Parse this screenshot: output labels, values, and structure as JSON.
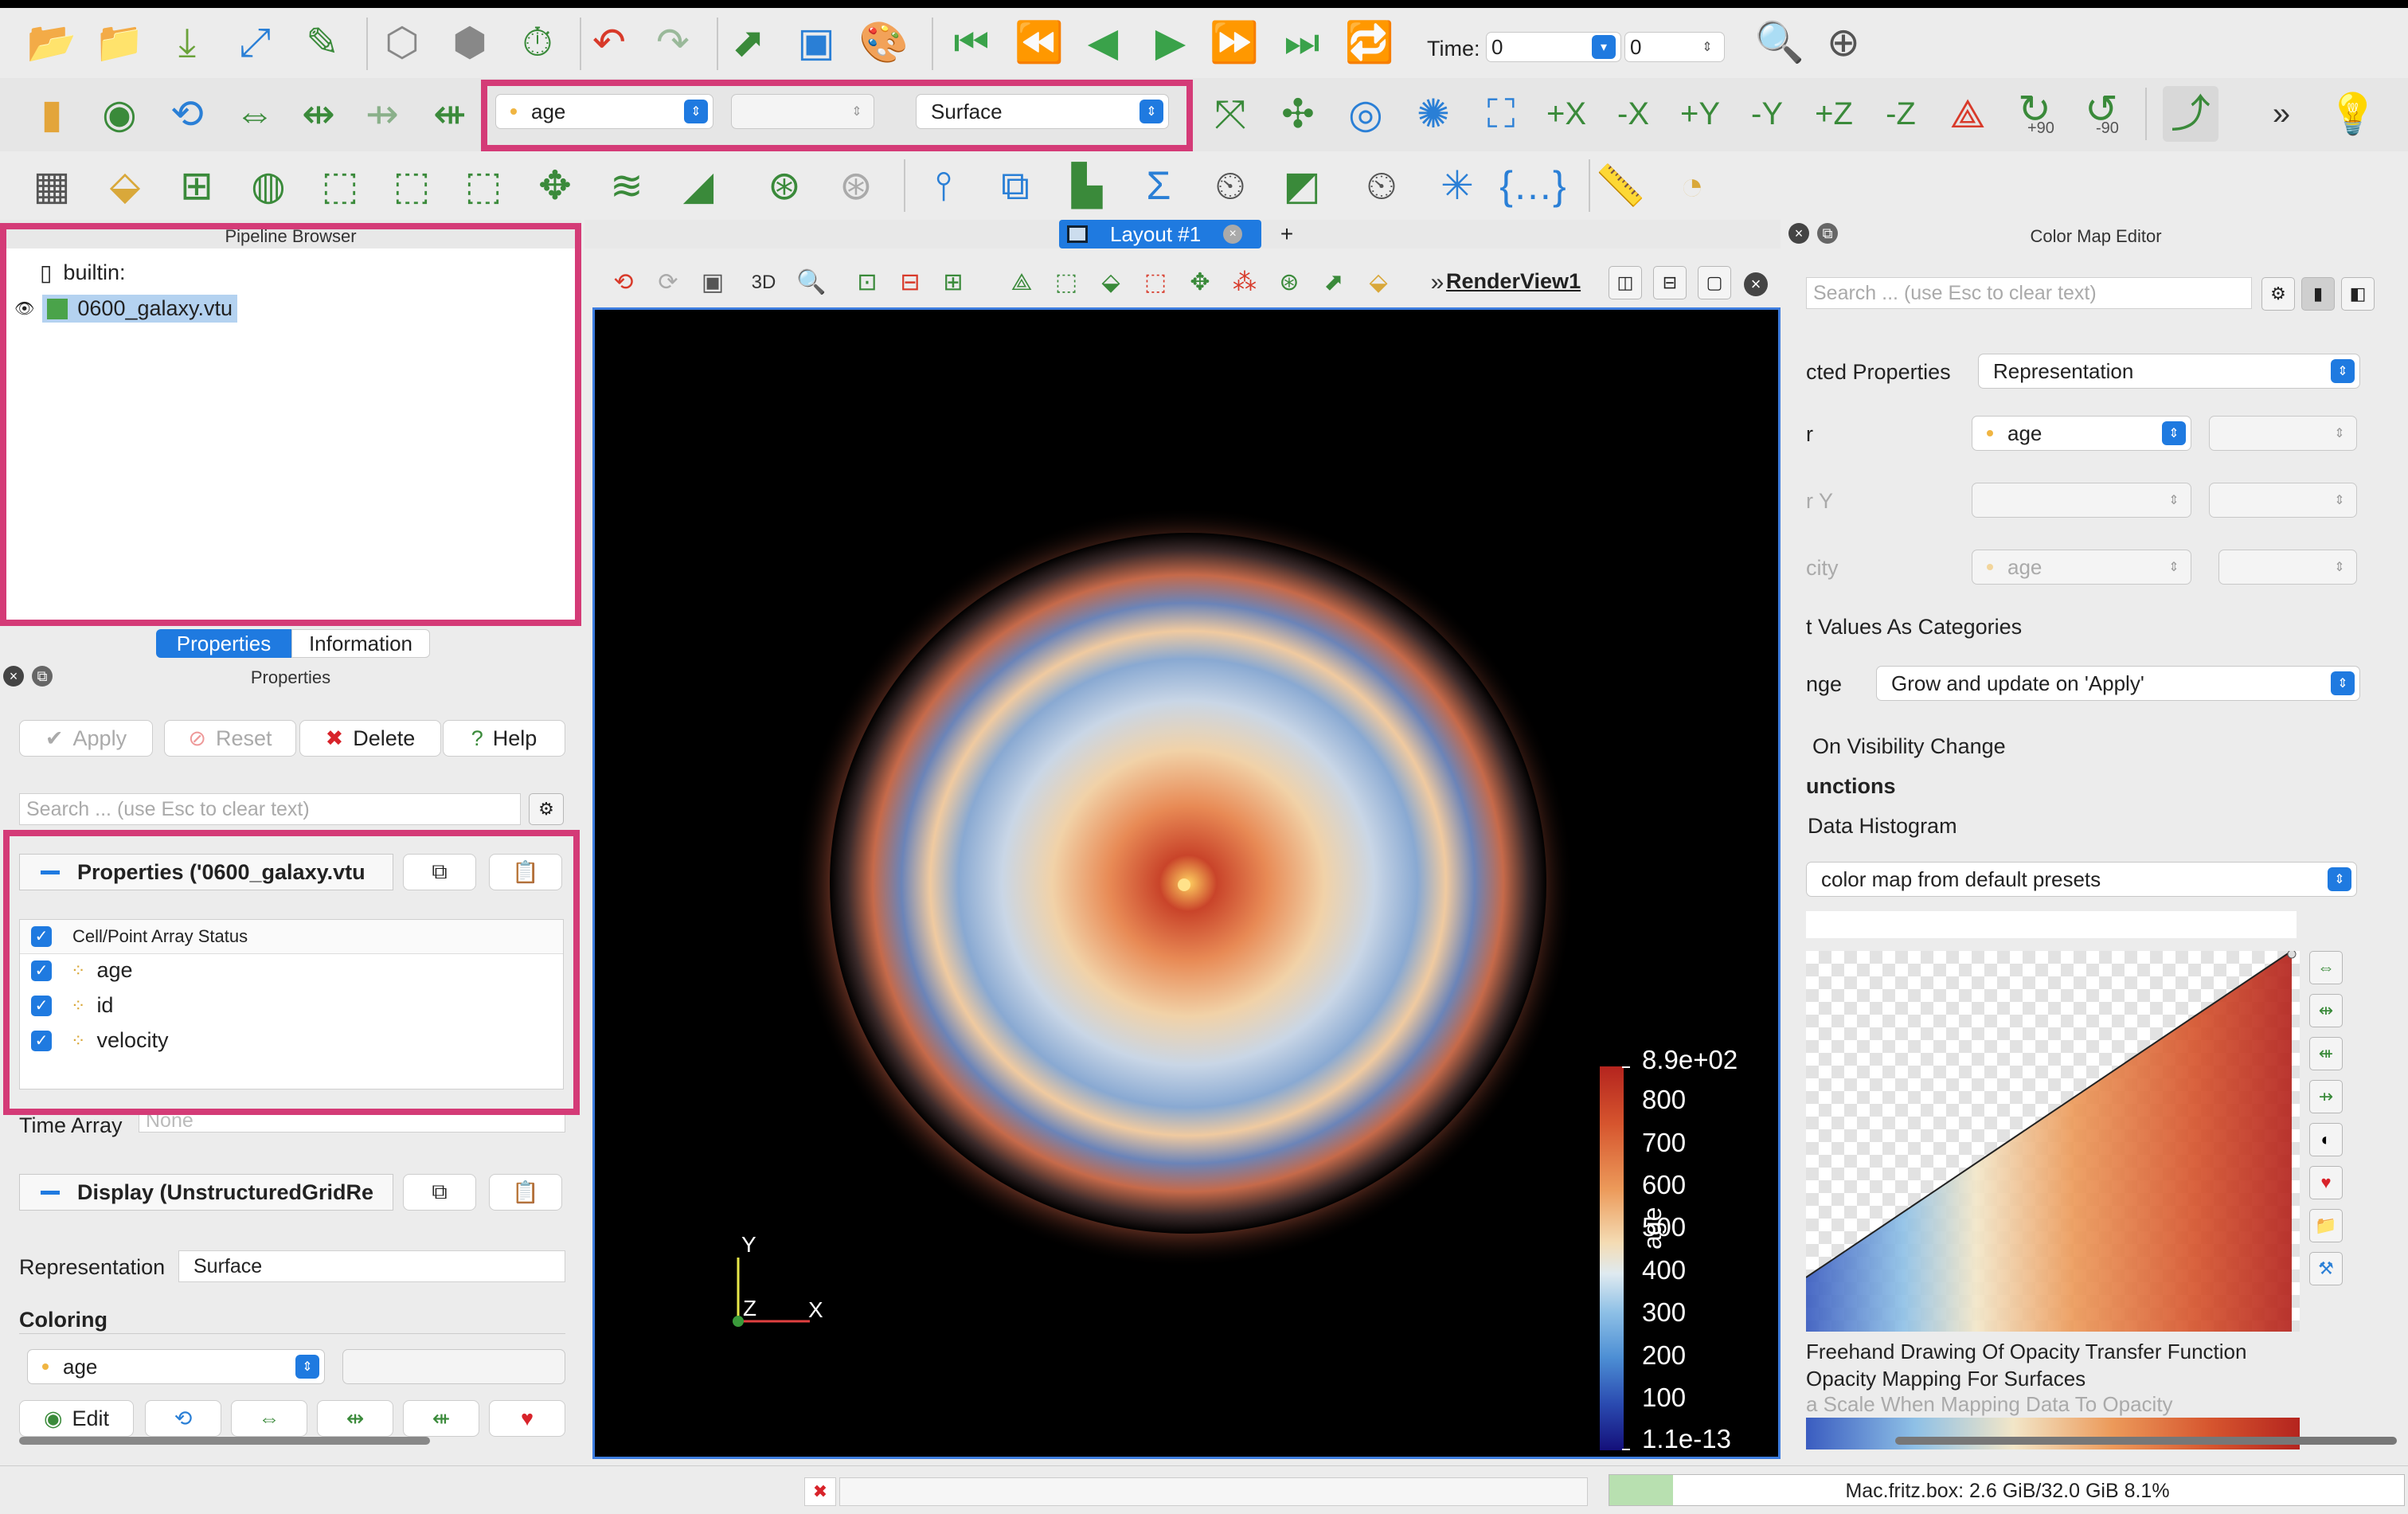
{
  "toolbar": {
    "time_label": "Time:",
    "time_value": "0",
    "time_step": "0",
    "color_array": "age",
    "component": "",
    "representation": "Surface",
    "rotate_plus_label": "+90",
    "rotate_minus_label": "-90"
  },
  "pipeline": {
    "title": "Pipeline Browser",
    "items": [
      {
        "label": "builtin:"
      },
      {
        "label": "0600_galaxy.vtu"
      }
    ]
  },
  "tabs": {
    "properties": "Properties",
    "information": "Information"
  },
  "properties": {
    "title": "Properties",
    "apply": "Apply",
    "reset": "Reset",
    "delete": "Delete",
    "help": "Help",
    "search_placeholder": "Search ... (use Esc to clear text)",
    "section_props": "Properties ('0600_galaxy.vtu",
    "array_status_header": "Cell/Point Array Status",
    "arrays": [
      {
        "label": "age"
      },
      {
        "label": "id"
      },
      {
        "label": "velocity"
      }
    ],
    "time_array_label": "Time Array",
    "time_array_value": "None",
    "section_display": "Display (UnstructuredGridRe",
    "representation_label": "Representation",
    "representation_value": "Surface",
    "coloring_label": "Coloring",
    "coloring_array": "age",
    "edit_label": "Edit"
  },
  "layout": {
    "tab": "Layout #1",
    "add": "+"
  },
  "view": {
    "title": "RenderView1",
    "mode_3d": "3D",
    "axes": {
      "x": "X",
      "y": "Y",
      "z": "Z"
    },
    "colorbar": {
      "title": "age",
      "ticks": [
        "8.9e+02",
        "800",
        "700",
        "600",
        "500",
        "400",
        "300",
        "200",
        "100",
        "1.1e-13"
      ]
    }
  },
  "colormap": {
    "title": "Color Map Editor",
    "search_placeholder": "Search ... (use Esc to clear text)",
    "selected_props_label": "cted Properties",
    "selected_props_value": "Representation",
    "color_label": "r",
    "color_value": "age",
    "color_y_label": "r Y",
    "opacity_label": "city",
    "opacity_value": "age",
    "categories": "t Values As Categories",
    "range_label": "nge",
    "range_value": "Grow and update on 'Apply'",
    "visibility": "On Visibility Change",
    "functions": "unctions",
    "histogram": "Data Histogram",
    "preset": "color map from default presets",
    "freehand": "Freehand Drawing Of Opacity Transfer Function",
    "opacity_surfaces": "Opacity Mapping For Surfaces",
    "scale_opacity": "a Scale When Mapping Data To Opacity"
  },
  "status": {
    "memory": "Mac.fritz.box: 2.6 GiB/32.0 GiB 8.1%"
  },
  "colors": {
    "accent": "#1f7ae0",
    "highlight": "#d43b77",
    "render_bg": "#000000"
  }
}
